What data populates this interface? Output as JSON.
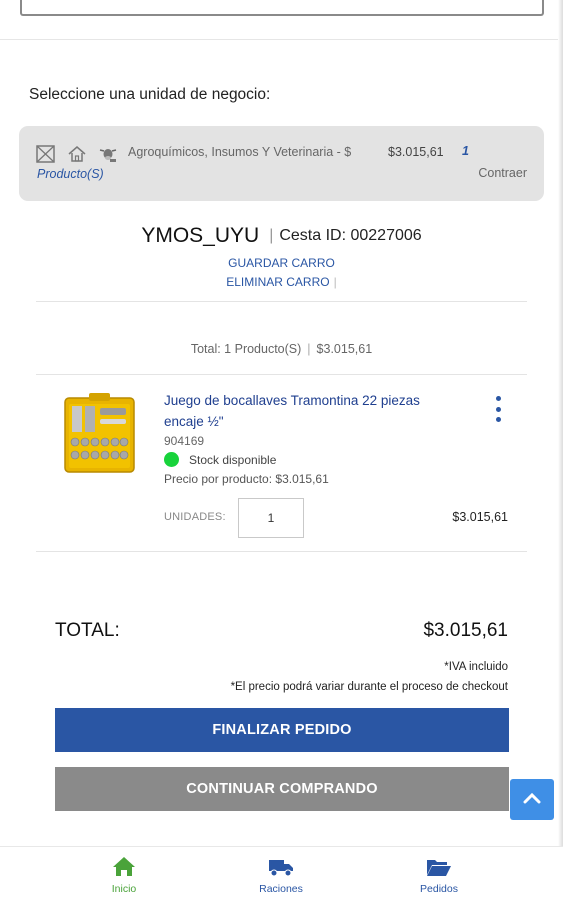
{
  "header": {
    "select_label": "Seleccione una unidad de negocio:"
  },
  "business_unit": {
    "name": "Agroquímicos, Insumos Y Veterinaria - $",
    "price": "$3.015,61",
    "count": "1",
    "products_label": "Producto(S)",
    "collapse_label": "Contraer",
    "icons": [
      "crossed-box-icon",
      "house-icon",
      "cow-icon"
    ]
  },
  "cart": {
    "name": "YMOS_UYU",
    "id_label": "Cesta ID:",
    "id": "00227006",
    "save_label": "GUARDAR CARRO",
    "delete_label": "ELIMINAR CARRO",
    "summary_count": "Total: 1 Producto(S)",
    "summary_total": "$3.015,61"
  },
  "product": {
    "title": "Juego de bocallaves Tramontina 22 piezas encaje ½\"",
    "code": "904169",
    "stock": "Stock disponible",
    "unit_price": "Precio por producto: $3.015,61",
    "units_label": "UNIDADES:",
    "quantity": "1",
    "line_total": "$3.015,61",
    "stock_color": "#18d33b"
  },
  "totals": {
    "label": "TOTAL:",
    "value": "$3.015,61",
    "iva_note": "*IVA incluido",
    "price_note": "*El precio podrá variar durante el proceso de checkout"
  },
  "actions": {
    "finish_label": "FINALIZAR PEDIDO",
    "continue_label": "CONTINUAR COMPRANDO"
  },
  "nav": {
    "home": "Inicio",
    "rations": "Raciones",
    "orders": "Pedidos"
  },
  "colors": {
    "primary": "#2a56a4",
    "secondary_button": "#8a8a8a",
    "active_nav": "#4aa33a",
    "scroll_button": "#3f8fe6"
  }
}
